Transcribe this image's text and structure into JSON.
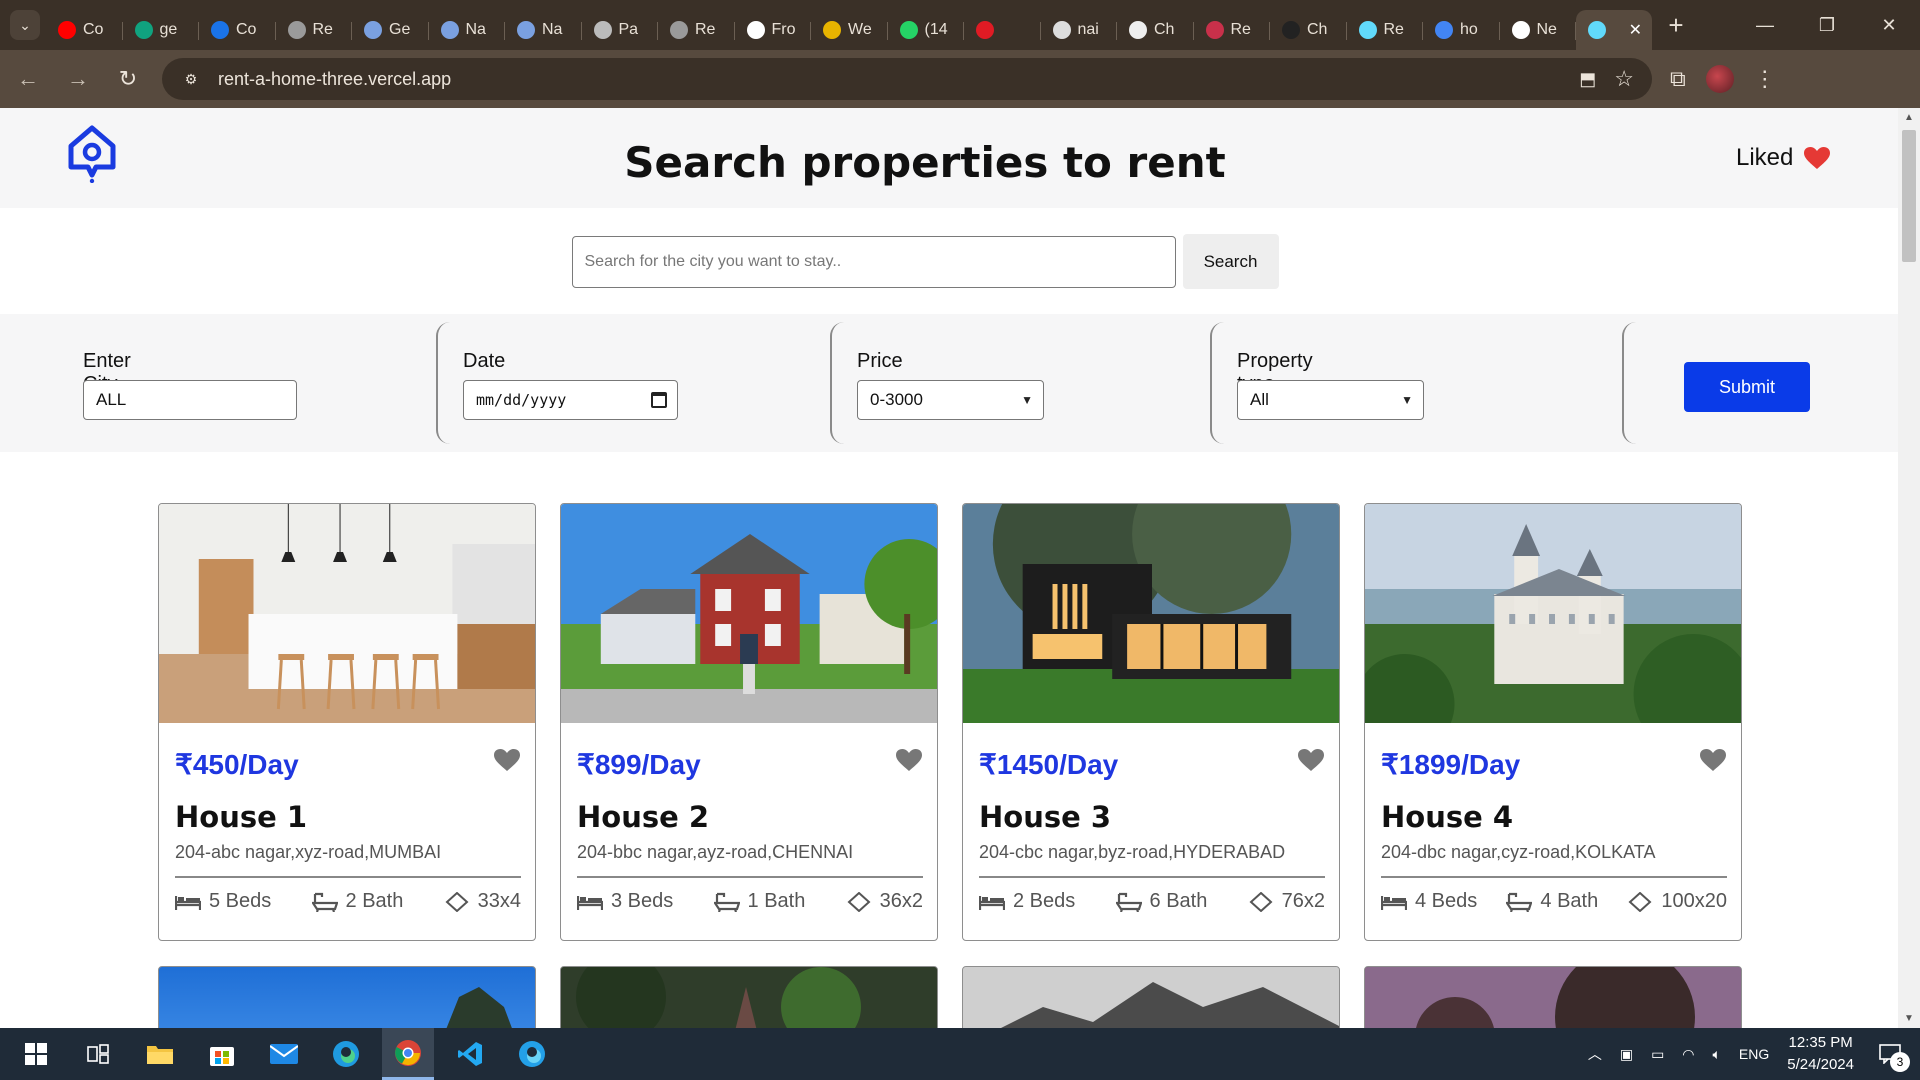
{
  "browser": {
    "tabs": [
      {
        "title": "Co",
        "favicon": "youtube-icon",
        "color": "#ff0000"
      },
      {
        "title": "ge",
        "favicon": "chatgpt-icon",
        "color": "#10a37f"
      },
      {
        "title": "Co",
        "favicon": "contacts-icon",
        "color": "#1a73e8"
      },
      {
        "title": "Re",
        "favicon": "globe-icon",
        "color": "#9a9a9a"
      },
      {
        "title": "Ge",
        "favicon": "globe-icon",
        "color": "#7aa0e0"
      },
      {
        "title": "Na",
        "favicon": "globe-icon",
        "color": "#7aa0e0"
      },
      {
        "title": "Na",
        "favicon": "globe-icon",
        "color": "#7aa0e0"
      },
      {
        "title": "Pa",
        "favicon": "globe-icon",
        "color": "#bbbbbb"
      },
      {
        "title": "Re",
        "favicon": "globe-icon",
        "color": "#9a9a9a"
      },
      {
        "title": "Fro",
        "favicon": "frontend-icon",
        "color": "#ffffff"
      },
      {
        "title": "We",
        "favicon": "chrome-icon",
        "color": "#e8b400"
      },
      {
        "title": "(14",
        "favicon": "whatsapp-icon",
        "color": "#25d366"
      },
      {
        "title": "",
        "favicon": "recording-icon",
        "color": "#e01b24"
      },
      {
        "title": "nai",
        "favicon": "github-icon",
        "color": "#dddddd"
      },
      {
        "title": "Ch",
        "favicon": "openai-icon",
        "color": "#eeeeee"
      },
      {
        "title": "Re",
        "favicon": "redux-icon",
        "color": "#c8304a"
      },
      {
        "title": "Ch",
        "favicon": "openai-icon",
        "color": "#222222"
      },
      {
        "title": "Re",
        "favicon": "react-icon",
        "color": "#61dafb"
      },
      {
        "title": "ho",
        "favicon": "google-icon",
        "color": "#4285f4"
      },
      {
        "title": "Ne",
        "favicon": "vercel-icon",
        "color": "#ffffff"
      },
      {
        "title": "",
        "favicon": "react-icon",
        "color": "#61dafb",
        "active": true
      }
    ],
    "url": "rent-a-home-three.vercel.app"
  },
  "header": {
    "title": "Search properties to rent",
    "liked_label": "Liked",
    "accent": "#e53935"
  },
  "search": {
    "placeholder": "Search for the city you want to stay..",
    "value": "",
    "button_label": "Search"
  },
  "filters": {
    "city_label": "Enter City",
    "city_value": "ALL",
    "date_label": "Date",
    "date_value": "mm/dd/yyyy",
    "price_label": "Price",
    "price_value": "0-3000",
    "type_label": "Property type",
    "type_value": "All",
    "submit_label": "Submit",
    "submit_color": "#0a3be8"
  },
  "properties": [
    {
      "price": "₹450/Day",
      "name": "House 1",
      "address": "204-abc nagar,xyz-road,MUMBAI",
      "beds": "5 Beds",
      "bath": "2 Bath",
      "size": "33x4",
      "image": "kitchen"
    },
    {
      "price": "₹899/Day",
      "name": "House 2",
      "address": "204-bbc nagar,ayz-road,CHENNAI",
      "beds": "3 Beds",
      "bath": "1 Bath",
      "size": "36x2",
      "image": "red-house"
    },
    {
      "price": "₹1450/Day",
      "name": "House 3",
      "address": "204-cbc nagar,byz-road,HYDERABAD",
      "beds": "2 Beds",
      "bath": "6 Bath",
      "size": "76x2",
      "image": "modern-house-night"
    },
    {
      "price": "₹1899/Day",
      "name": "House 4",
      "address": "204-dbc nagar,cyz-road,KOLKATA",
      "beds": "4 Beds",
      "bath": "4 Bath",
      "size": "100x20",
      "image": "castle"
    }
  ],
  "price_color": "#1f37e0",
  "taskbar": {
    "apps": [
      "start-icon",
      "task-view-icon",
      "file-explorer-icon",
      "store-icon",
      "mail-icon",
      "edge-icon",
      "chrome-icon",
      "vscode-icon",
      "edge-dev-icon"
    ],
    "language": "ENG",
    "time": "12:35 PM",
    "date": "5/24/2024",
    "notifications": "3"
  }
}
